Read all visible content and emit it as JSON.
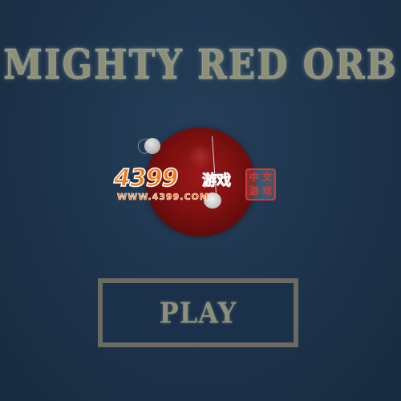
{
  "game": {
    "title": "MIGHTY RED ORB",
    "play_label": "PLAY"
  },
  "watermark": {
    "number": "4399",
    "cn": "游戏",
    "url": "WWW.4399.COM",
    "stamp": [
      "中",
      "文",
      "游",
      "戏"
    ]
  },
  "colors": {
    "background": "#1d334b",
    "title_text": "#8d8f77",
    "orb": "#7e1010",
    "button_border": "#6a6c63",
    "button_fill": "#1b3049",
    "watermark_orange": "#f07a1a",
    "stamp_red": "#d23b3b"
  },
  "icons": {
    "satellite": "small-gray-ball",
    "pendulum": "white-ball-on-string"
  }
}
